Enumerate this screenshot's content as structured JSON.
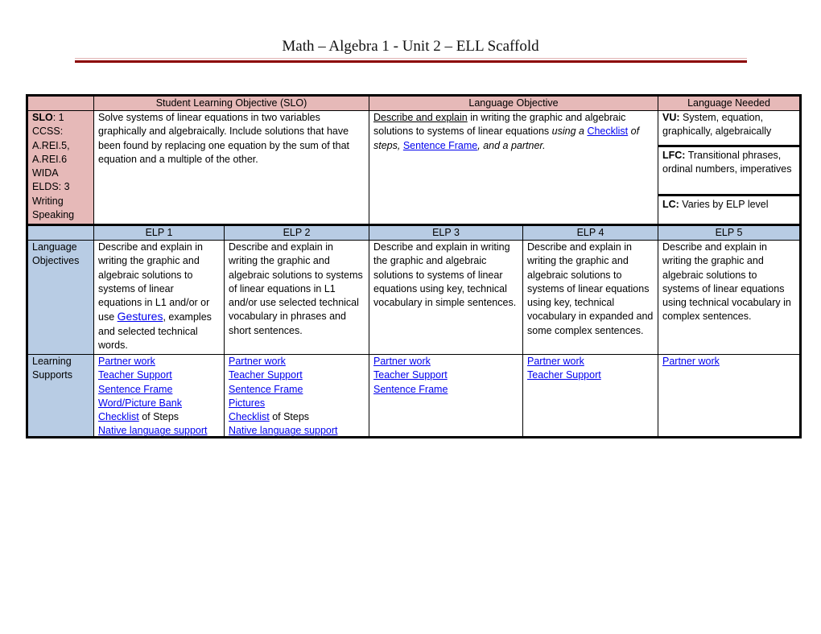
{
  "document": {
    "title": "Math – Algebra 1 - Unit 2 – ELL Scaffold"
  },
  "top_table": {
    "headers": {
      "blank": "",
      "slo": "Student Learning Objective (SLO)",
      "language_objective": "Language Objective",
      "language_needed": "Language Needed"
    },
    "standards": {
      "slo_label": "SLO",
      "slo_value": ": 1",
      "lines": [
        "CCSS:",
        "A.REI.5,",
        "A.REI.6",
        "WIDA",
        "ELDS: 3",
        "Writing",
        "Speaking"
      ]
    },
    "slo_text": "Solve systems of linear equations in two variables graphically and algebraically. Include solutions that have been found by replacing one equation by the sum of that equation and a multiple of the other.",
    "language_objective": {
      "part1_underlined": "Describe and explain",
      "part2": " in writing the graphic and algebraic solutions to systems of linear equations ",
      "part3_italic": "using a ",
      "link_checklist": "Checklist",
      "part4_italic": " of steps, ",
      "link_sentence_frame": "Sentence Frame",
      "part5_italic": ", and a partner."
    },
    "language_needed": {
      "vu_label": "VU:",
      "vu_text": " System, equation, graphically, algebraically",
      "lfc_label": "LFC:",
      "lfc_text": " Transitional phrases, ordinal numbers, imperatives",
      "lc_label": "LC:",
      "lc_text": " Varies by ELP level"
    }
  },
  "elp_table": {
    "headers": [
      "",
      "ELP 1",
      "ELP 2",
      "ELP 3",
      "ELP 4",
      "ELP 5"
    ],
    "row_labels": {
      "language_objectives": "Language Objectives",
      "learning_supports": "Learning Supports"
    },
    "language_objectives": {
      "elp1_before": "Describe and explain in writing the graphic and algebraic solutions to systems of linear equations in L1 and/or or use ",
      "elp1_link": "Gestures",
      "elp1_after": ", examples and selected technical words.",
      "elp2": "Describe and explain in writing the graphic and algebraic solutions to systems of linear equations in L1 and/or use selected technical vocabulary in phrases and short sentences.",
      "elp3": "Describe and explain in writing the graphic and algebraic solutions to systems of linear equations using key, technical vocabulary in simple sentences.",
      "elp4": "Describe and explain in writing the graphic and algebraic solutions to systems of linear equations using key, technical vocabulary in expanded and some complex sentences.",
      "elp5": "Describe and explain in writing the graphic and algebraic solutions to systems of linear equations using technical vocabulary in complex sentences."
    },
    "learning_supports": {
      "elp1": {
        "partner_work": "Partner work",
        "teacher_support": "Teacher Support",
        "sentence_frame": "Sentence Frame",
        "word_picture_bank": "Word/Picture Bank",
        "checklist": "Checklist",
        "of_steps": " of Steps",
        "native_language_support": "Native language support"
      },
      "elp2": {
        "partner_work": "Partner work",
        "teacher_support": "Teacher Support",
        "sentence_frame": "Sentence Frame",
        "pictures": "Pictures",
        "checklist": "Checklist",
        "of_steps": " of Steps",
        "native_language_support": "Native language support"
      },
      "elp3": {
        "partner_work": "Partner work",
        "teacher_support": "Teacher Support",
        "sentence_frame": "Sentence Frame"
      },
      "elp4": {
        "partner_work": "Partner work",
        "teacher_support": "Teacher Support"
      },
      "elp5": {
        "partner_work": "Partner work"
      }
    }
  },
  "colors": {
    "header_pink": "#e6b9b8",
    "header_blue": "#b8cce4",
    "title_rule": "#8b0000",
    "link": "#0000ee"
  }
}
